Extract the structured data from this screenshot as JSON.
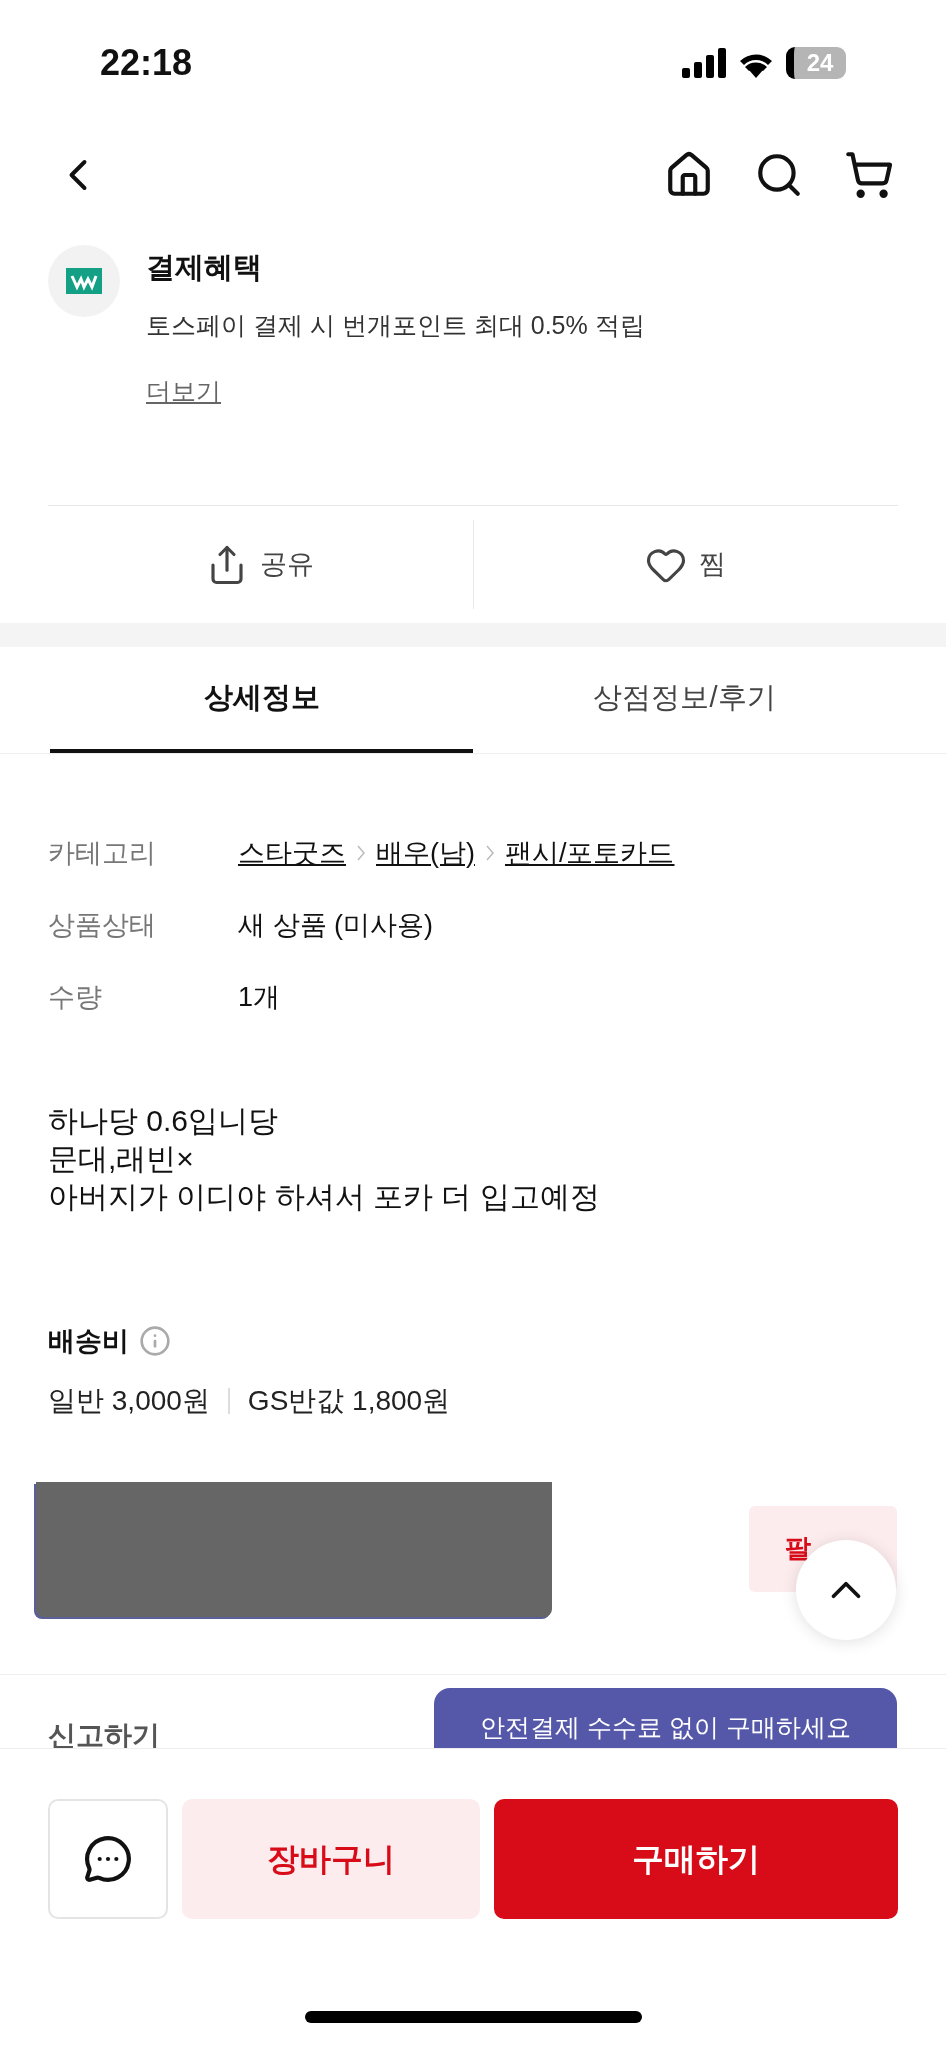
{
  "status_bar": {
    "time": "22:18",
    "battery": "24"
  },
  "benefit": {
    "title": "결제혜택",
    "text": "토스페이 결제 시 번개포인트 최대 0.5% 적립",
    "more": "더보기"
  },
  "actions": [
    {
      "kind": "share",
      "label": "공유"
    },
    {
      "kind": "like",
      "label": "찜"
    }
  ],
  "tabs": [
    {
      "label": "상세정보",
      "selected": true
    },
    {
      "label": "상점정보/후기",
      "selected": false
    }
  ],
  "info": [
    {
      "kind": "category",
      "label": "카테고리",
      "values": [
        "스타굿즈",
        "배우(남)",
        "팬시/포토카드"
      ]
    },
    {
      "kind": "text",
      "label": "상품상태",
      "values": [
        "새 상품 (미사용)"
      ]
    },
    {
      "kind": "text",
      "label": "수량",
      "values": [
        "1개"
      ]
    }
  ],
  "description": [
    "하나당 0.6입니당",
    "문대,래빈×",
    "아버지가 이디야 하셔서 포카 더 입고예정"
  ],
  "shipping": {
    "title": "배송비",
    "options": [
      "일반 3,000원",
      "GS반값 1,800원"
    ]
  },
  "store": {
    "follow": "팔"
  },
  "report": "신고하기",
  "tooltip": "안전결제 수수료 없이 구매하세요",
  "bottom_bar": {
    "cart": "장바구니",
    "buy": "구매하기"
  }
}
